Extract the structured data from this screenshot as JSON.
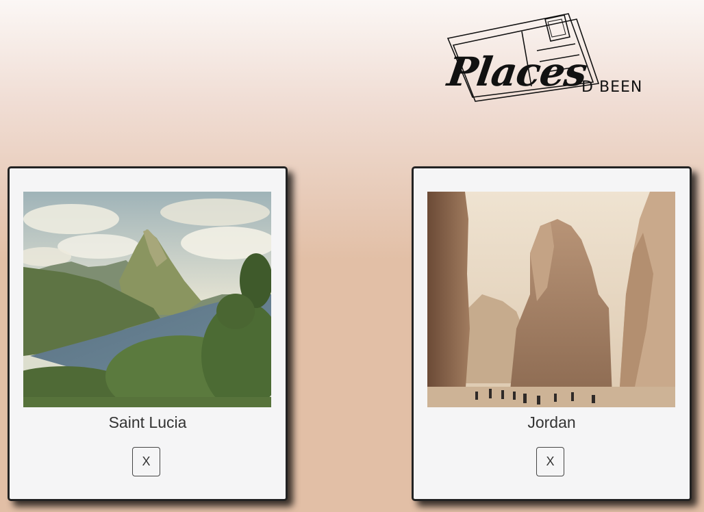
{
  "logo": {
    "title": "Places",
    "subtitle": "'D BEEN"
  },
  "places": [
    {
      "name": "Saint Lucia",
      "image": "pitons-mountain-landscape-photo",
      "remove_label": "X"
    },
    {
      "name": "Jordan",
      "image": "petra-canyon-cliffs-photo",
      "remove_label": "X"
    }
  ],
  "colors": {
    "background_top": "#fbf7f5",
    "background_bottom": "#e2bfa6",
    "card": "#f5f5f6",
    "card_border": "#222222"
  }
}
